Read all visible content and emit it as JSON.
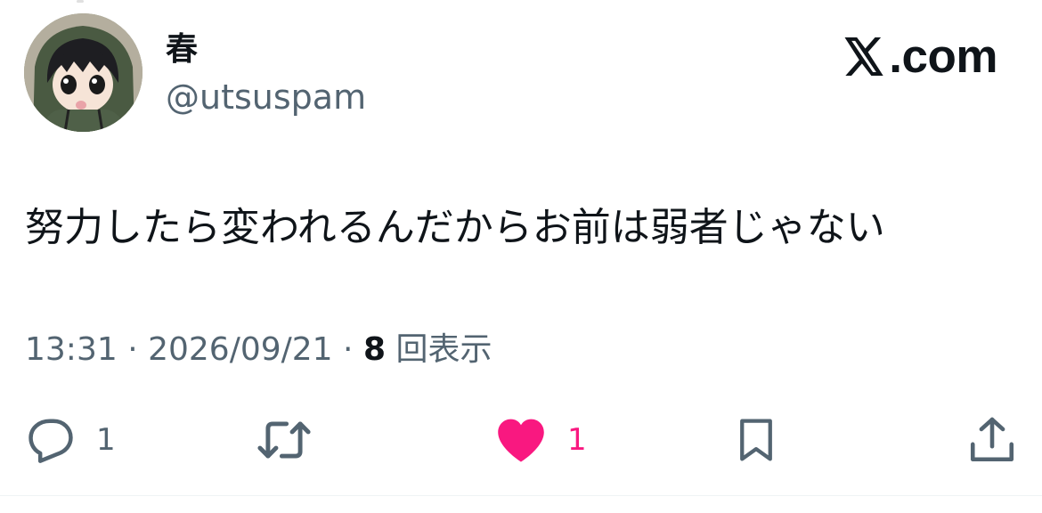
{
  "user": {
    "display_name": "春",
    "handle": "@utsuspam",
    "avatar_icon": "anime-character-avatar"
  },
  "brand": {
    "logo_icon": "x-logo-icon",
    "text": ".com"
  },
  "tweet": {
    "text": "努力したら変われるんだからお前は弱者じゃない"
  },
  "meta": {
    "time": "13:31",
    "separator_1": " · ",
    "date": "2026/09/21",
    "separator_2": " · ",
    "views_count": "8",
    "views_label": " 回表示"
  },
  "actions": {
    "reply": {
      "icon": "reply-icon",
      "count": "1"
    },
    "repost": {
      "icon": "repost-icon",
      "count": ""
    },
    "like": {
      "icon": "heart-icon",
      "count": "1",
      "liked": true
    },
    "bookmark": {
      "icon": "bookmark-icon",
      "count": ""
    },
    "share": {
      "icon": "share-icon",
      "count": ""
    }
  },
  "colors": {
    "text_primary": "#0f1419",
    "text_secondary": "#536471",
    "like_pink": "#f91880",
    "divider": "#eff3f4"
  }
}
